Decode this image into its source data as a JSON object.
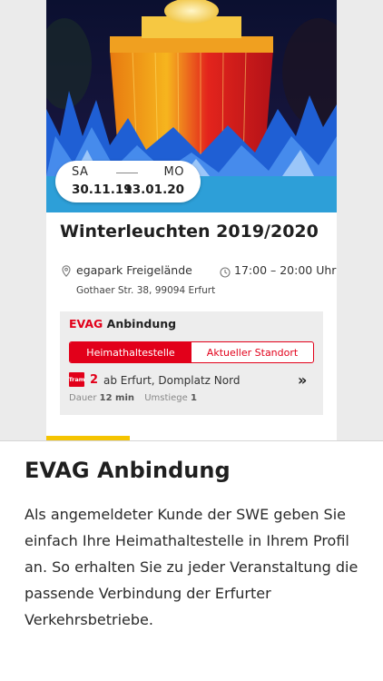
{
  "event": {
    "date_start_day": "SA",
    "date_start": "30.11.19",
    "date_end_day": "MO",
    "date_end": "13.01.20",
    "title": "Winterleuchten 2019/2020",
    "location_name": "egapark Freigelände",
    "location_address": "Gothaer Str. 38, 99094 Erfurt",
    "time": "17:00 – 20:00 Uhr"
  },
  "evag": {
    "brand": "EVAG",
    "heading_rest": " Anbindung",
    "tabs": [
      {
        "label": "Heimathaltestelle",
        "active": true
      },
      {
        "label": "Aktueller Standort",
        "active": false
      }
    ],
    "connection": {
      "mode": "Tram",
      "line": "2",
      "route": "ab Erfurt, Domplatz Nord",
      "duration_label": "Dauer",
      "duration": "12 min",
      "transfers_label": "Umstiege",
      "transfers": "1"
    }
  },
  "panel": {
    "title": "EVAG Anbindung",
    "body": "Als angemeldeter Kunde der SWE geben Sie einfach Ihre Heimathaltestelle in Ihrem Profil an. So erhalten Sie zu jeder Veranstaltung die passende Verbindung der Erfurter Verkehrsbetriebe."
  },
  "icons": {
    "location": "map-pin-icon",
    "time": "clock-icon",
    "tram": "tram-icon",
    "forward": "double-chevron-right-icon"
  },
  "colors": {
    "accent_red": "#e2001a",
    "strip_blue": "#2d9fd8",
    "tab_yellow": "#f5c400"
  }
}
